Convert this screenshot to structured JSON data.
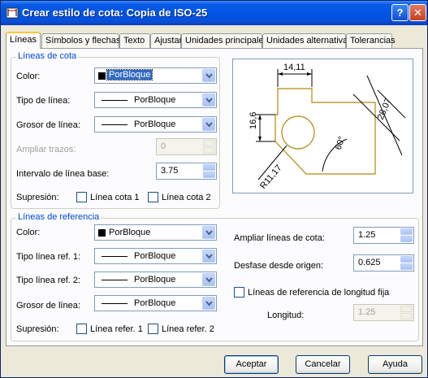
{
  "window": {
    "title": "Crear estilo de cota: Copia de ISO-25",
    "help_label": "?",
    "close_label": "✕"
  },
  "tabs": [
    {
      "label": "Líneas"
    },
    {
      "label": "Símbolos y flechas"
    },
    {
      "label": "Texto"
    },
    {
      "label": "Ajustar"
    },
    {
      "label": "Unidades principales"
    },
    {
      "label": "Unidades alternativas"
    },
    {
      "label": "Tolerancias"
    }
  ],
  "dim_lines": {
    "group_title": "Líneas de cota",
    "color_label": "Color:",
    "color_value": "PorBloque",
    "linetype_label": "Tipo de línea:",
    "linetype_value": "PorBloque",
    "lineweight_label": "Grosor de línea:",
    "lineweight_value": "PorBloque",
    "extend_ticks_label": "Ampliar trazos:",
    "extend_ticks_value": "0",
    "baseline_spacing_label": "Intervalo de línea base:",
    "baseline_spacing_value": "3.75",
    "suppress_label": "Supresión:",
    "suppress_1": "Línea cota 1",
    "suppress_2": "Línea cota 2"
  },
  "ext_lines": {
    "group_title": "Líneas de referencia",
    "color_label": "Color:",
    "color_value": "PorBloque",
    "linetype1_label": "Tipo línea ref. 1:",
    "linetype1_value": "PorBloque",
    "linetype2_label": "Tipo línea ref. 2:",
    "linetype2_value": "PorBloque",
    "lineweight_label": "Grosor de línea:",
    "lineweight_value": "PorBloque",
    "suppress_label": "Supresión:",
    "suppress_1": "Línea refer. 1",
    "suppress_2": "Línea refer. 2",
    "extend_label": "Ampliar líneas de cota:",
    "extend_value": "1.25",
    "offset_label": "Desfase desde origen:",
    "offset_value": "0.625",
    "fixed_length_label": "Líneas de referencia de longitud fija",
    "length_label": "Longitud:",
    "length_value": "1.25"
  },
  "preview": {
    "dim_top": "14,11",
    "dim_left": "16,6",
    "dim_right": "28,07",
    "dim_angle": "60°",
    "dim_radius": "R11,17"
  },
  "buttons": {
    "ok": "Aceptar",
    "cancel": "Cancelar",
    "help": "Ayuda"
  },
  "colors": {
    "title_bar": "#0054e3",
    "group_title": "#0046d5",
    "selection": "#316ac5",
    "preview_geometry": "#b8860b"
  }
}
